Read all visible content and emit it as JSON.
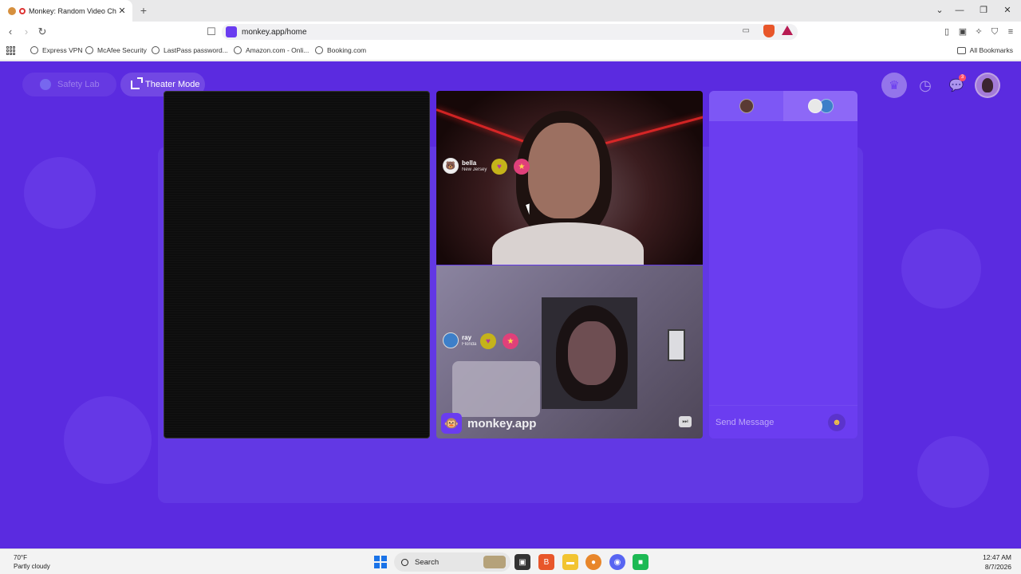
{
  "browser": {
    "tab_title": "Monkey: Random Video Chat",
    "url": "monkey.app/home",
    "window_controls": {
      "minimize": "—",
      "restore": "❐",
      "close": "✕",
      "tab_list": "⌄"
    },
    "bookmarks": [
      "Express VPN",
      "McAfee Security",
      "LastPass password...",
      "Amazon.com - Onli...",
      "Booking.com"
    ],
    "all_bookmarks": "All Bookmarks"
  },
  "page": {
    "safety_lab": "Safety Lab",
    "theater_mode": "Theater Mode",
    "chat_notification_count": "3",
    "brand": "monkey.app",
    "send_message_placeholder": "Send Message"
  },
  "participants": [
    {
      "name": "bella",
      "location": "New Jersey"
    },
    {
      "name": "ray",
      "location": "Florida"
    }
  ],
  "taskbar": {
    "weather_temp": "70°F",
    "weather_desc": "Partly cloudy",
    "search": "Search",
    "time": "12:47 AM",
    "date": "8/7/2026"
  },
  "colors": {
    "page_bg": "#5b2be0",
    "chat_panel": "#6b3df0",
    "accent": "#6a3cf0"
  }
}
